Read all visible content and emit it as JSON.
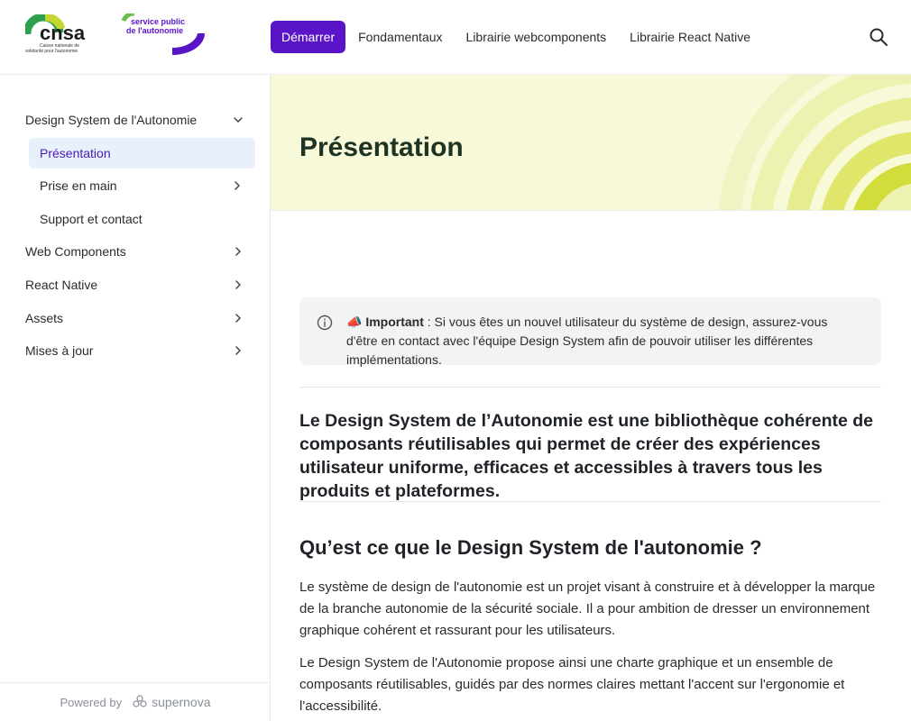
{
  "header": {
    "logo_cnsa": {
      "name": "cnsa",
      "tagline": "Caisse nationale de solidarité pour l'autonomie"
    },
    "logo_sp": {
      "line1": "service public",
      "line2": "de l'autonomie"
    },
    "nav": [
      {
        "label": "Démarrer",
        "active": true
      },
      {
        "label": "Fondamentaux",
        "active": false
      },
      {
        "label": "Librairie webcomponents",
        "active": false
      },
      {
        "label": "Librairie React Native",
        "active": false
      }
    ],
    "search_icon": "search-icon"
  },
  "sidebar": {
    "sections": [
      {
        "label": "Design System de l'Autonomie",
        "expanded": true
      },
      {
        "label": "Web Components",
        "expanded": false
      },
      {
        "label": "React Native",
        "expanded": false
      },
      {
        "label": "Assets",
        "expanded": false
      },
      {
        "label": "Mises à jour",
        "expanded": false
      }
    ],
    "subitems": [
      {
        "label": "Présentation",
        "active": true
      },
      {
        "label": "Prise en main",
        "has_children": true
      },
      {
        "label": "Support et contact",
        "has_children": false
      }
    ],
    "footer": {
      "powered_by": "Powered by",
      "brand": "supernova"
    }
  },
  "hero": {
    "title": "Présentation"
  },
  "callout": {
    "emoji": "📣",
    "strong": "Important",
    "text": " : Si vous êtes un nouvel utilisateur du système de design, assurez-vous d'être en contact avec l'équipe Design System afin de pouvoir utiliser les différentes implémentations."
  },
  "content": {
    "lead": "Le Design System de l’Autonomie est une bibliothèque cohérente de composants réutilisables qui permet de créer des expériences utilisateur uniforme, efficaces et accessibles à travers tous les produits et plateformes.",
    "h2": "Qu’est ce que le Design System de l'autonomie ?",
    "p1": "Le système de design de l'autonomie est un projet visant à construire et à développer la marque de la branche autonomie de la sécurité sociale. Il a pour ambition de dresser un environnement graphique cohérent et rassurant pour les utilisateurs.",
    "p2": "Le Design System de l'Autonomie propose ainsi une charte graphique et un ensemble de composants réutilisables, guidés par des normes claires mettant l'accent sur l'ergonomie et l'accessibilité."
  },
  "colors": {
    "accent": "#5a14c8",
    "hero_bg": "#f7f9d9",
    "active_sub_bg": "#e8f0fb",
    "title_green": "#1e3322"
  }
}
